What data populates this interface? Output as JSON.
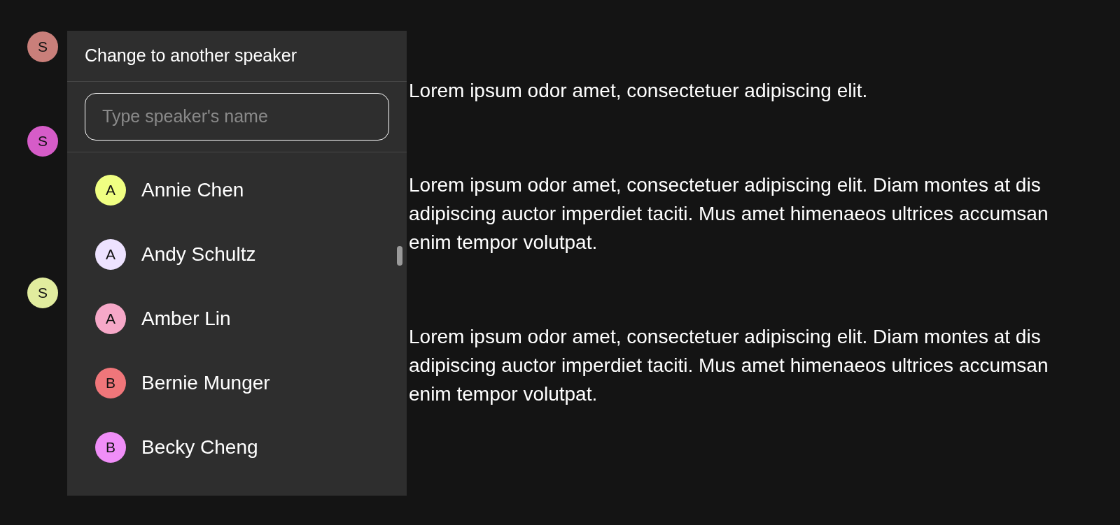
{
  "transcript": [
    {
      "avatar": "S",
      "color": "#c97f7a",
      "text": "Lorem ipsum odor amet, consectetuer adipiscing elit."
    },
    {
      "avatar": "S",
      "color": "#d65cc8",
      "text": "Lorem ipsum odor amet, consectetuer adipiscing elit. Diam montes at dis adipiscing auctor imperdiet taciti. Mus amet himenaeos ultrices accumsan enim tempor volutpat."
    },
    {
      "avatar": "S",
      "color": "#e1ec9e",
      "text": "Lorem ipsum odor amet, consectetuer adipiscing elit. Diam montes at dis adipiscing auctor imperdiet taciti. Mus amet himenaeos ultrices accumsan enim tempor volutpat."
    }
  ],
  "speaker_menu": {
    "title": "Change to another speaker",
    "search": {
      "placeholder": "Type speaker's name"
    },
    "speakers": [
      {
        "initial": "A",
        "name": "Annie Chen",
        "color": "#f0ff82"
      },
      {
        "initial": "A",
        "name": "Andy Schultz",
        "color": "#ede2ff"
      },
      {
        "initial": "A",
        "name": "Amber Lin",
        "color": "#f6a8c8"
      },
      {
        "initial": "B",
        "name": "Bernie Munger",
        "color": "#f0767a"
      },
      {
        "initial": "B",
        "name": "Becky Cheng",
        "color": "#f08ef8"
      }
    ]
  }
}
